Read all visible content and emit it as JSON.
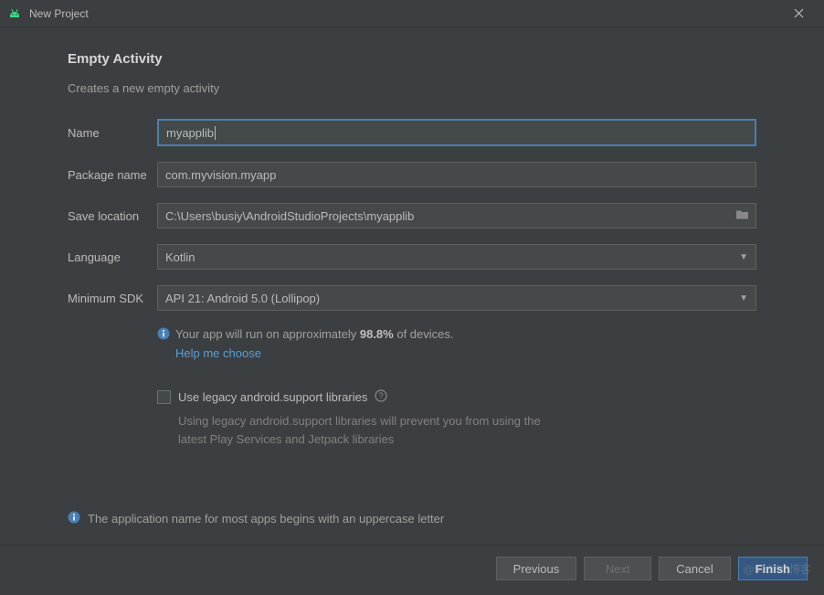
{
  "titlebar": {
    "title": "New Project"
  },
  "page": {
    "title": "Empty Activity",
    "subtitle": "Creates a new empty activity"
  },
  "form": {
    "name": {
      "label": "Name",
      "value": "myapplib"
    },
    "package": {
      "label": "Package name",
      "value": "com.myvision.myapp"
    },
    "saveLocation": {
      "label": "Save location",
      "value": "C:\\Users\\busiy\\AndroidStudioProjects\\myapplib"
    },
    "language": {
      "label": "Language",
      "value": "Kotlin"
    },
    "minSdk": {
      "label": "Minimum SDK",
      "value": "API 21: Android 5.0 (Lollipop)"
    }
  },
  "info": {
    "deviceText1": "Your app will run on approximately ",
    "devicePercent": "98.8%",
    "deviceText2": " of devices.",
    "helpLink": "Help me choose"
  },
  "legacy": {
    "label": "Use legacy android.support libraries",
    "hint": "Using legacy android.support libraries will prevent you from using the latest Play Services and Jetpack libraries"
  },
  "warning": {
    "text": "The application name for most apps begins with an uppercase letter"
  },
  "buttons": {
    "previous": "Previous",
    "next": "Next",
    "cancel": "Cancel",
    "finish": "Finish"
  },
  "watermark": "@51CTO博客"
}
